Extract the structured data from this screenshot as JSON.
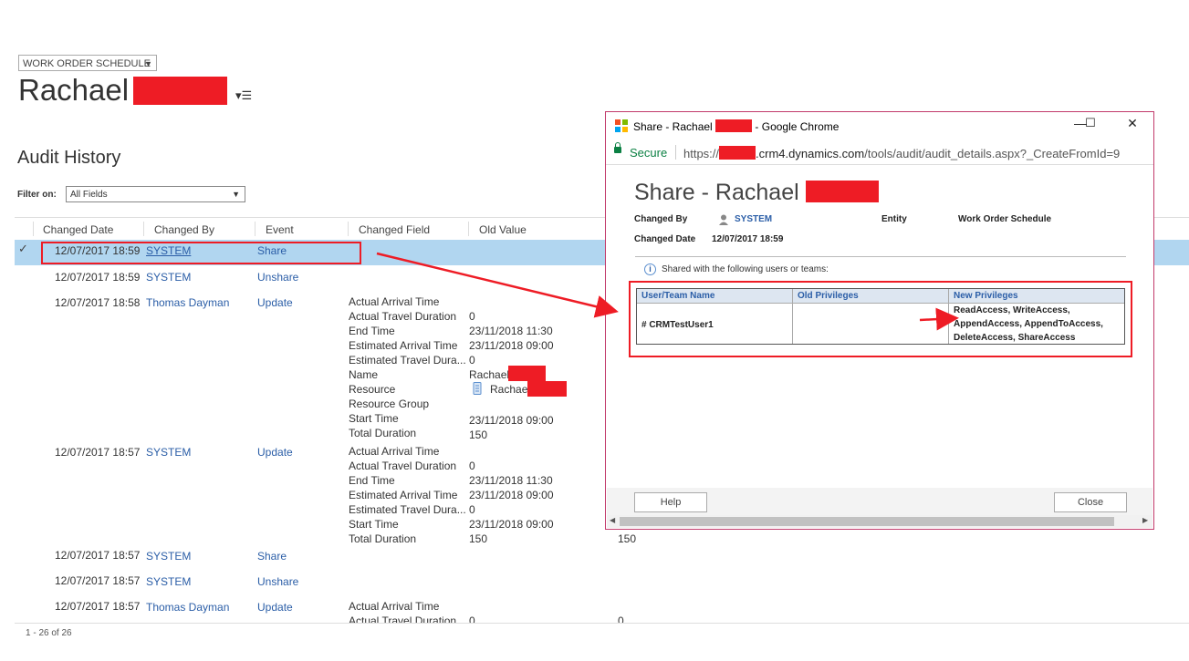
{
  "header": {
    "form_selector": "WORK ORDER SCHEDULE",
    "record_name": "Rachael",
    "menu_icon": "list-menu-icon"
  },
  "audit": {
    "title": "Audit History",
    "filter_label": "Filter on:",
    "filter_value": "All Fields",
    "columns": [
      "Changed Date",
      "Changed By",
      "Event",
      "Changed Field",
      "Old Value"
    ],
    "rows": [
      {
        "date": "12/07/2017 18:59",
        "by": "SYSTEM",
        "event": "Share",
        "fields": []
      },
      {
        "date": "12/07/2017 18:59",
        "by": "SYSTEM",
        "event": "Unshare",
        "fields": []
      },
      {
        "date": "12/07/2017 18:58",
        "by": "Thomas Dayman",
        "event": "Update",
        "fields": [
          {
            "name": "Actual Arrival Time",
            "old": ""
          },
          {
            "name": "Actual Travel Duration",
            "old": "0"
          },
          {
            "name": "End Time",
            "old": "23/11/2018 11:30"
          },
          {
            "name": "Estimated Arrival Time",
            "old": "23/11/2018 09:00"
          },
          {
            "name": "Estimated Travel Dura...",
            "old": "0"
          },
          {
            "name": "Name",
            "old": "Rachael"
          },
          {
            "name": "Resource",
            "old": "Rachael"
          },
          {
            "name": "Resource Group",
            "old": ""
          },
          {
            "name": "Start Time",
            "old": "23/11/2018 09:00"
          },
          {
            "name": "Total Duration",
            "old": "150"
          }
        ]
      },
      {
        "date": "12/07/2017 18:57",
        "by": "SYSTEM",
        "event": "Update",
        "fields": [
          {
            "name": "Actual Arrival Time",
            "old": ""
          },
          {
            "name": "Actual Travel Duration",
            "old": "0"
          },
          {
            "name": "End Time",
            "old": "23/11/2018 11:30"
          },
          {
            "name": "Estimated Arrival Time",
            "old": "23/11/2018 09:00"
          },
          {
            "name": "Estimated Travel Dura...",
            "old": "0"
          },
          {
            "name": "Start Time",
            "old": "23/11/2018 09:00"
          },
          {
            "name": "Total Duration",
            "old": "150",
            "new": "150"
          }
        ]
      },
      {
        "date": "12/07/2017 18:57",
        "by": "SYSTEM",
        "event": "Share",
        "fields": []
      },
      {
        "date": "12/07/2017 18:57",
        "by": "SYSTEM",
        "event": "Unshare",
        "fields": []
      },
      {
        "date": "12/07/2017 18:57",
        "by": "Thomas Dayman",
        "event": "Update",
        "fields": [
          {
            "name": "Actual Arrival Time",
            "old": ""
          },
          {
            "name": "Actual Travel Duration",
            "old": "0",
            "new": "0"
          }
        ]
      }
    ],
    "footer": "1 - 26 of 26"
  },
  "popup": {
    "window_title_prefix": "Share - Rachael",
    "window_title_suffix": "- Google Chrome",
    "secure_label": "Secure",
    "url_prefix": "https://",
    "url_domain": ".crm4.dynamics.com",
    "url_path": "/tools/audit/audit_details.aspx?_CreateFromId=9",
    "dialog_title": "Share - Rachael",
    "changed_by_label": "Changed By",
    "changed_by_value": "SYSTEM",
    "entity_label": "Entity",
    "entity_value": "Work Order Schedule",
    "changed_date_label": "Changed Date",
    "changed_date_value": "12/07/2017 18:59",
    "shared_text": "Shared with the following users or teams:",
    "table_headers": [
      "User/Team Name",
      "Old Privileges",
      "New Privileges"
    ],
    "user": "# CRMTestUser1",
    "new_privileges": [
      "ReadAccess, WriteAccess,",
      "AppendAccess, AppendToAccess,",
      "DeleteAccess, ShareAccess"
    ],
    "help_label": "Help",
    "close_label": "Close"
  },
  "colors": {
    "accent_link": "#2b5ea7",
    "selected_row": "#b1d6f0",
    "annotation_red": "#ee1c25",
    "secure_green": "#0b8043"
  }
}
